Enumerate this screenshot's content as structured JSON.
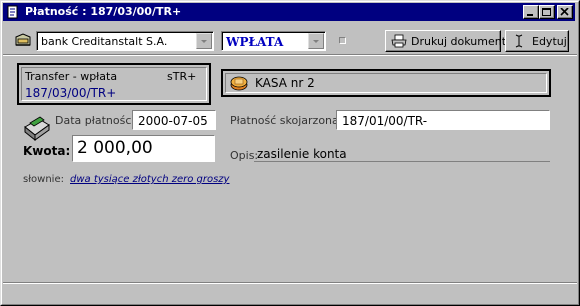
{
  "window": {
    "title": "Płatność : 187/03/00/TR+"
  },
  "toolbar": {
    "bank_value": "bank Creditanstalt S.A.",
    "type_value": "WPŁATA",
    "type_color": "#0000c0",
    "print_label": "Drukuj dokument",
    "edit_label": "Edytuj"
  },
  "transfer": {
    "label": "Transfer - wpłata",
    "code": "sTR+",
    "number": "187/03/00/TR+"
  },
  "kasa": {
    "label": "KASA nr 2"
  },
  "payment": {
    "date_label": "Data płatności:",
    "date_value": "2000-07-05",
    "linked_label": "Płatność skojarzona:",
    "linked_value": "187/01/00/TR-",
    "amount_label": "Kwota:",
    "amount_value": "2 000,00",
    "description_label": "Opis:",
    "description_value": "zasilenie konta",
    "words_label": "słownie:",
    "words_value": "dwa tysiące złotych zero groszy",
    "words_color": "#000080"
  }
}
